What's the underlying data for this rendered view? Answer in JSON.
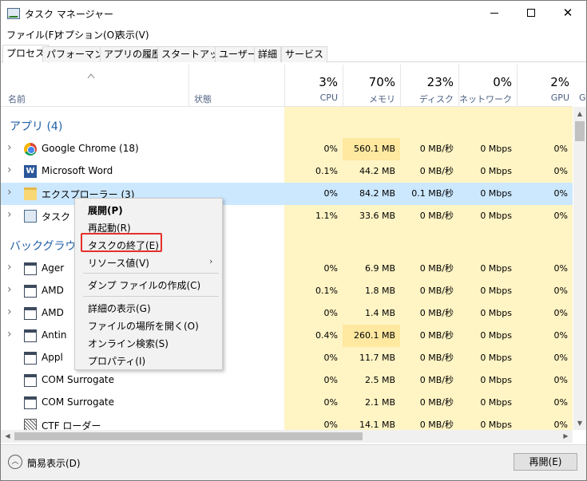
{
  "window": {
    "title": "タスク マネージャー"
  },
  "menu": [
    "ファイル(F)",
    "オプション(O)",
    "表示(V)"
  ],
  "tabs": [
    "プロセス",
    "パフォーマンス",
    "アプリの履歴",
    "スタートアップ",
    "ユーザー",
    "詳細",
    "サービス"
  ],
  "columns": {
    "name": "名前",
    "status": "状態",
    "cpu": {
      "pct": "3%",
      "label": "CPU"
    },
    "memory": {
      "pct": "70%",
      "label": "メモリ"
    },
    "disk": {
      "pct": "23%",
      "label": "ディスク"
    },
    "network": {
      "pct": "0%",
      "label": "ネットワーク"
    },
    "gpu": {
      "pct": "2%",
      "label": "GPU"
    },
    "gpu_engine": {
      "label": "G"
    }
  },
  "groups": {
    "apps": "アプリ (4)",
    "background": "バックグラウ"
  },
  "rows": [
    {
      "name": "Google Chrome (18)",
      "icon": "chrome-icon",
      "cpu": "0%",
      "mem": "560.1 MB",
      "disk": "0 MB/秒",
      "net": "0 Mbps",
      "gpu": "0%"
    },
    {
      "name": "Microsoft Word",
      "icon": "word-icon",
      "cpu": "0.1%",
      "mem": "44.2 MB",
      "disk": "0 MB/秒",
      "net": "0 Mbps",
      "gpu": "0%"
    },
    {
      "name": "エクスプローラー (3)",
      "icon": "explorer-icon",
      "cpu": "0%",
      "mem": "84.2 MB",
      "disk": "0.1 MB/秒",
      "net": "0 Mbps",
      "gpu": "0%"
    },
    {
      "name": "タスク",
      "icon": "task-manager-icon",
      "cpu": "1.1%",
      "mem": "33.6 MB",
      "disk": "0 MB/秒",
      "net": "0 Mbps",
      "gpu": "0%"
    },
    {
      "name": "Ager",
      "icon": "window-icon",
      "cpu": "0%",
      "mem": "6.9 MB",
      "disk": "0 MB/秒",
      "net": "0 Mbps",
      "gpu": "0%"
    },
    {
      "name": "AMD",
      "icon": "window-icon",
      "cpu": "0.1%",
      "mem": "1.8 MB",
      "disk": "0 MB/秒",
      "net": "0 Mbps",
      "gpu": "0%"
    },
    {
      "name": "AMD",
      "icon": "window-icon",
      "cpu": "0%",
      "mem": "1.4 MB",
      "disk": "0 MB/秒",
      "net": "0 Mbps",
      "gpu": "0%"
    },
    {
      "name": "Antin",
      "icon": "window-icon",
      "cpu": "0.4%",
      "mem": "260.1 MB",
      "disk": "0 MB/秒",
      "net": "0 Mbps",
      "gpu": "0%"
    },
    {
      "name": "Appl",
      "icon": "window-icon",
      "cpu": "0%",
      "mem": "11.7 MB",
      "disk": "0 MB/秒",
      "net": "0 Mbps",
      "gpu": "0%"
    },
    {
      "name": "COM Surrogate",
      "icon": "window-icon",
      "cpu": "0%",
      "mem": "2.5 MB",
      "disk": "0 MB/秒",
      "net": "0 Mbps",
      "gpu": "0%"
    },
    {
      "name": "COM Surrogate",
      "icon": "window-icon",
      "cpu": "0%",
      "mem": "2.1 MB",
      "disk": "0 MB/秒",
      "net": "0 Mbps",
      "gpu": "0%"
    },
    {
      "name": "CTF ローダー",
      "icon": "ctf-icon",
      "cpu": "0%",
      "mem": "14.1 MB",
      "disk": "0 MB/秒",
      "net": "0 Mbps",
      "gpu": "0%"
    }
  ],
  "context_menu": {
    "expand": "展開(P)",
    "restart": "再起動(R)",
    "end_task": "タスクの終了(E)",
    "resource_values": "リソース値(V)",
    "dump": "ダンプ ファイルの作成(C)",
    "details": "詳細の表示(G)",
    "open_location": "ファイルの場所を開く(O)",
    "search_online": "オンライン検索(S)",
    "properties": "プロパティ(I)"
  },
  "footer": {
    "fewer_details": "簡易表示(D)",
    "resume": "再開(E)"
  },
  "colors": {
    "highlight": "#e5302a",
    "selected": "#cce8ff",
    "group": "#1f5fa6"
  }
}
